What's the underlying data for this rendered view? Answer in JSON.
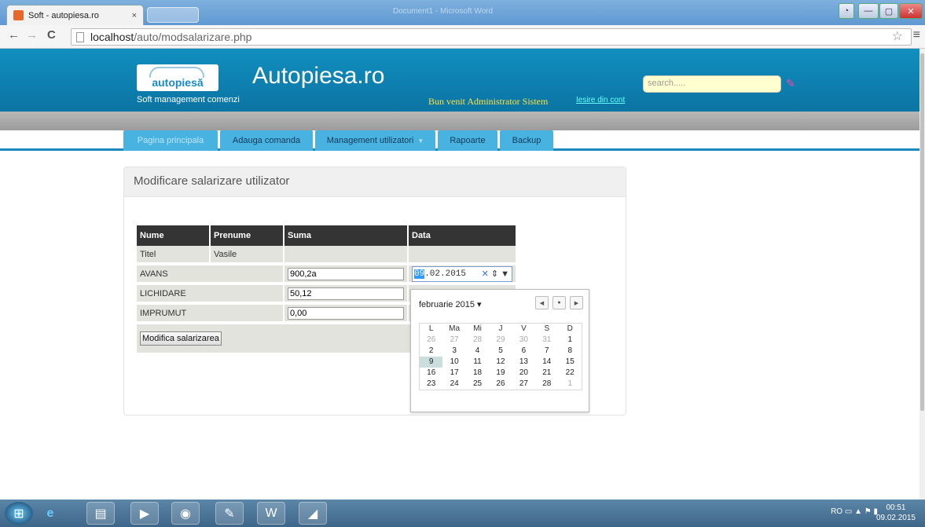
{
  "browser": {
    "tab_title": "Soft - autopiesa.ro",
    "tab_close": "×",
    "window_title": "Document1 - Microsoft Word",
    "url_host": "localhost",
    "url_path": "/auto/modsalarizare.php",
    "minimize": "—",
    "maximize": "▢",
    "close": "✕"
  },
  "header": {
    "logo_text": "autopiesă",
    "site_name": "Autopiesa.ro",
    "subtitle": "Soft management comenzi",
    "welcome": "Bun venit Administrator Sistem",
    "logout": "Iesire din cont",
    "search_placeholder": "search....."
  },
  "nav": [
    {
      "label": "Pagina principala"
    },
    {
      "label": "Adauga comanda"
    },
    {
      "label": "Management utilizatori"
    },
    {
      "label": "Rapoarte"
    },
    {
      "label": "Backup"
    }
  ],
  "panel": {
    "title": "Modificare salarizare utilizator",
    "table": {
      "headers": [
        "Nume",
        "Prenume",
        "Suma",
        "Data"
      ],
      "nume": "Titel",
      "prenume": "Vasile",
      "rows": [
        {
          "label": "AVANS",
          "value": "900,2a"
        },
        {
          "label": "LICHIDARE",
          "value": "50,12"
        },
        {
          "label": "IMPRUMUT",
          "value": "0,00"
        }
      ],
      "submit": "Modifica salarizarea"
    },
    "date": {
      "day": "09",
      "rest": ".02.2015"
    }
  },
  "calendar": {
    "month": "februarie 2015",
    "weekdays": [
      "L",
      "Ma",
      "Mi",
      "J",
      "V",
      "S",
      "D"
    ],
    "weeks": [
      [
        "26",
        "27",
        "28",
        "29",
        "30",
        "31",
        "1"
      ],
      [
        "2",
        "3",
        "4",
        "5",
        "6",
        "7",
        "8"
      ],
      [
        "9",
        "10",
        "11",
        "12",
        "13",
        "14",
        "15"
      ],
      [
        "16",
        "17",
        "18",
        "19",
        "20",
        "21",
        "22"
      ],
      [
        "23",
        "24",
        "25",
        "26",
        "27",
        "28",
        "1"
      ]
    ],
    "selected": "9"
  },
  "taskbar": {
    "lang": "RO",
    "time": "00:51",
    "date": "09.02.2015"
  }
}
